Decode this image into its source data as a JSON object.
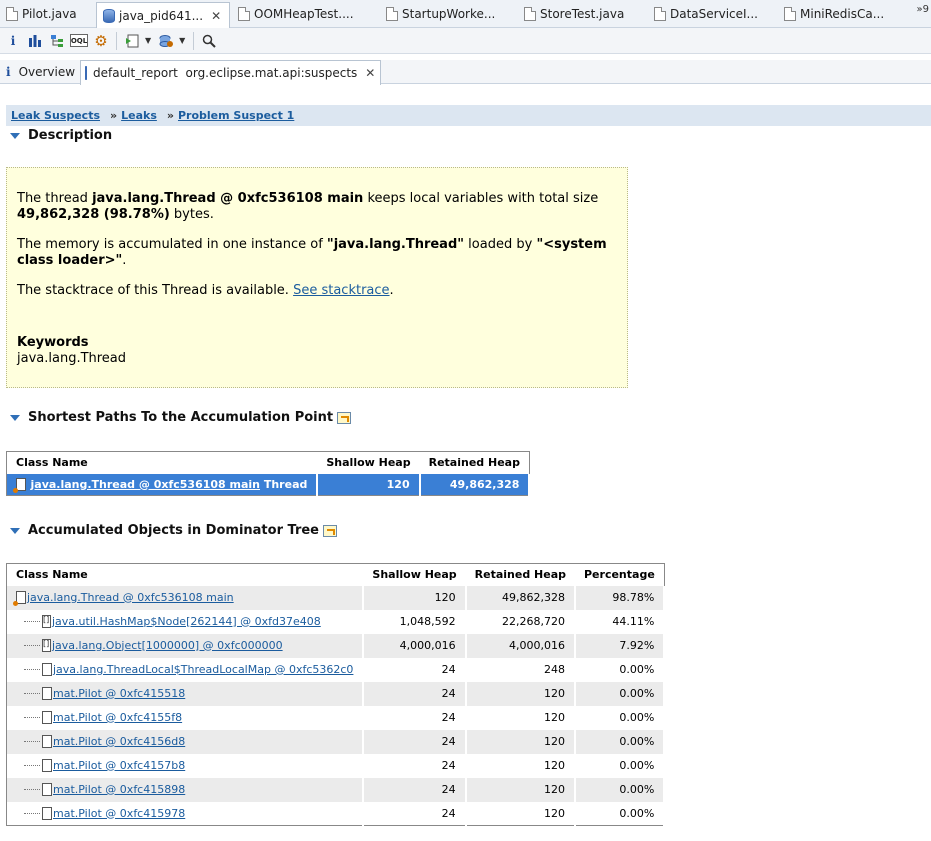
{
  "editor_tabs": [
    {
      "label": "Pilot.java",
      "icon": "java-file-icon"
    },
    {
      "label": "java_pid641...",
      "icon": "heap-dump-icon",
      "closable": true
    },
    {
      "label": "OOMHeapTest....",
      "icon": "java-file-icon"
    },
    {
      "label": "StartupWorke...",
      "icon": "java-file-icon"
    },
    {
      "label": "StoreTest.java",
      "icon": "java-file-icon"
    },
    {
      "label": "DataServiceI...",
      "icon": "java-file-icon"
    },
    {
      "label": "MiniRedisCa...",
      "icon": "java-file-icon"
    }
  ],
  "more_tabs": "»9",
  "sub_tabs": {
    "overview": "Overview",
    "report": "default_report  org.eclipse.mat.api:suspects"
  },
  "breadcrumb": {
    "items": [
      "Leak Suspects",
      "Leaks",
      "Problem Suspect 1"
    ],
    "separator": "»"
  },
  "description": {
    "title": "Description",
    "p1_pre": "The thread ",
    "p1_bold": "java.lang.Thread @ 0xfc536108 main",
    "p1_mid": " keeps local variables with total size ",
    "p1_bold2": "49,862,328 (98.78%)",
    "p1_post": " bytes.",
    "p2_pre": "The memory is accumulated in one instance of ",
    "p2_bold": "\"java.lang.Thread\"",
    "p2_mid": " loaded by ",
    "p2_bold2": "\"<system class loader>\"",
    "p2_post": ".",
    "p3_pre": "The stacktrace of this Thread is available. ",
    "p3_link": "See stacktrace",
    "p3_post": ".",
    "keywords_title": "Keywords",
    "keywords": "java.lang.Thread"
  },
  "shortest_paths": {
    "title": "Shortest Paths To the Accumulation Point",
    "headers": [
      "Class Name",
      "Shallow Heap",
      "Retained Heap"
    ],
    "row": {
      "link": "java.lang.Thread @ 0xfc536108 main",
      "suffix": " Thread",
      "shallow": "120",
      "retained": "49,862,328"
    }
  },
  "dominator": {
    "title": "Accumulated Objects in Dominator Tree",
    "headers": [
      "Class Name",
      "Shallow Heap",
      "Retained Heap",
      "Percentage"
    ],
    "rows": [
      {
        "name": "java.lang.Thread @ 0xfc536108 main",
        "shallow": "120",
        "retained": "49,862,328",
        "pct": "98.78%"
      },
      {
        "name": "java.util.HashMap$Node[262144] @ 0xfd37e408",
        "shallow": "1,048,592",
        "retained": "22,268,720",
        "pct": "44.11%"
      },
      {
        "name": "java.lang.Object[1000000] @ 0xfc000000",
        "shallow": "4,000,016",
        "retained": "4,000,016",
        "pct": "7.92%"
      },
      {
        "name": "java.lang.ThreadLocal$ThreadLocalMap @ 0xfc5362c0",
        "shallow": "24",
        "retained": "248",
        "pct": "0.00%"
      },
      {
        "name": "mat.Pilot @ 0xfc415518",
        "shallow": "24",
        "retained": "120",
        "pct": "0.00%"
      },
      {
        "name": "mat.Pilot @ 0xfc4155f8",
        "shallow": "24",
        "retained": "120",
        "pct": "0.00%"
      },
      {
        "name": "mat.Pilot @ 0xfc4156d8",
        "shallow": "24",
        "retained": "120",
        "pct": "0.00%"
      },
      {
        "name": "mat.Pilot @ 0xfc4157b8",
        "shallow": "24",
        "retained": "120",
        "pct": "0.00%"
      },
      {
        "name": "mat.Pilot @ 0xfc415898",
        "shallow": "24",
        "retained": "120",
        "pct": "0.00%"
      },
      {
        "name": "mat.Pilot @ 0xfc415978",
        "shallow": "24",
        "retained": "120",
        "pct": "0.00%"
      }
    ]
  }
}
